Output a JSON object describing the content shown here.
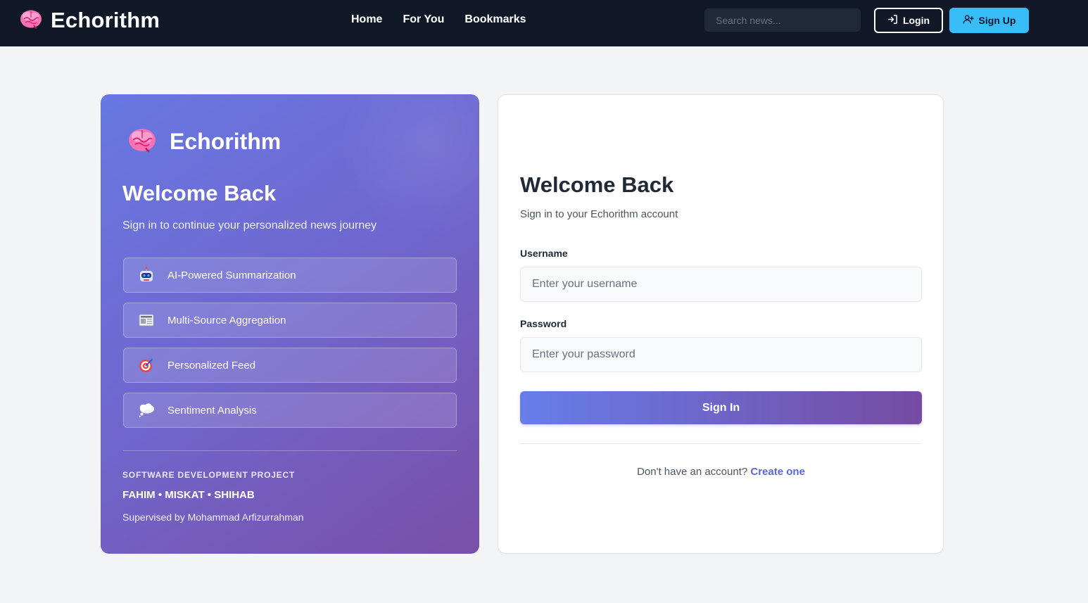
{
  "navbar": {
    "brand_icon": "brain-icon",
    "brand": "Echorithm",
    "links": [
      {
        "label": "Home"
      },
      {
        "label": "For You"
      },
      {
        "label": "Bookmarks"
      }
    ],
    "search_placeholder": "Search news...",
    "login_label": "Login",
    "login_icon": "login-arrow-icon",
    "signup_label": "Sign Up",
    "signup_icon": "user-plus-icon",
    "colors": {
      "background": "#111827",
      "signup_bg": "#38bdf8"
    }
  },
  "promo": {
    "brand_icon": "brain-icon",
    "brand": "Echorithm",
    "title": "Welcome Back",
    "subtitle": "Sign in to continue your personalized news journey",
    "features": [
      {
        "icon": "robot-icon",
        "label": "AI-Powered Summarization"
      },
      {
        "icon": "newspaper-icon",
        "label": "Multi-Source Aggregation"
      },
      {
        "icon": "target-icon",
        "label": "Personalized Feed"
      },
      {
        "icon": "thought-bubble-icon",
        "label": "Sentiment Analysis"
      }
    ],
    "project_label": "SOFTWARE DEVELOPMENT PROJECT",
    "team": "FAHIM • MISKAT • SHIHAB",
    "supervisor": "Supervised by Mohammad Arfizurrahman",
    "colors": {
      "gradient_start": "#6878e2",
      "gradient_end": "#7a4fa8"
    }
  },
  "login": {
    "title": "Welcome Back",
    "subtitle": "Sign in to your Echorithm account",
    "username_label": "Username",
    "username_placeholder": "Enter your username",
    "username_value": "",
    "password_label": "Password",
    "password_placeholder": "Enter your password",
    "password_value": "",
    "submit_label": "Sign In",
    "footer_text": "Don't have an account?",
    "footer_link": "Create one",
    "colors": {
      "button_start": "#667eea",
      "button_end": "#764ba2",
      "link": "#5a67d8"
    }
  }
}
